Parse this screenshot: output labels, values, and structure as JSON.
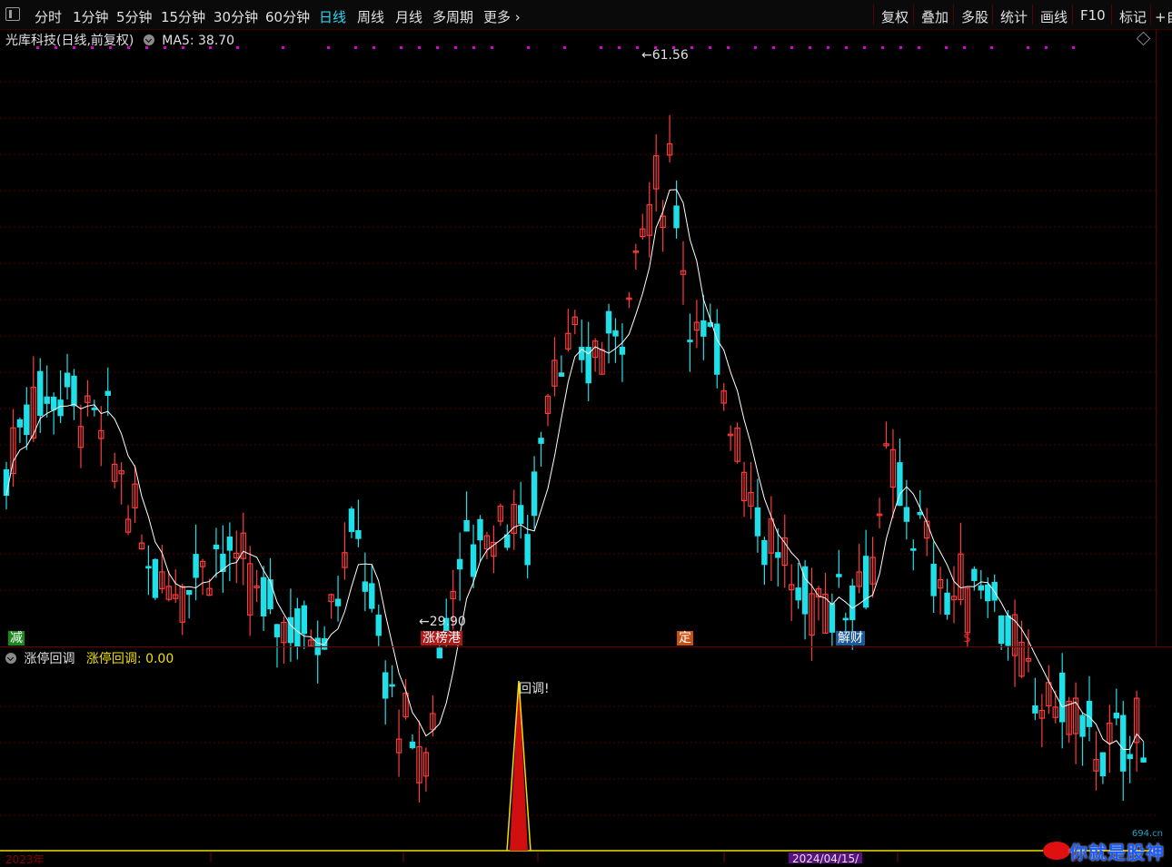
{
  "toolbar": {
    "periods": [
      "分时",
      "1分钟",
      "5分钟",
      "15分钟",
      "30分钟",
      "60分钟",
      "日线",
      "周线",
      "月线",
      "多周期",
      "更多"
    ],
    "active_period": "日线",
    "right_buttons": [
      "复权",
      "叠加",
      "多股",
      "统计",
      "画线",
      "F10",
      "标记",
      "+自"
    ]
  },
  "main_chart": {
    "stock_title": "光库科技(日线,前复权)",
    "ma_label": "MA5: 38.70",
    "high_label": "61.56",
    "low_label": "29.90",
    "colors": {
      "up": "#ff3b3b",
      "down": "#1fe0e8",
      "ma5": "#ffffff",
      "signal": "#e000e0",
      "grid": "#5a0000"
    }
  },
  "tags": [
    {
      "text": "减",
      "color": "#ffffff",
      "bg": "#1a8a1a"
    },
    {
      "text": "涨榜港",
      "color": "#ffffff",
      "bg": "#b01818"
    },
    {
      "text": "定",
      "color": "#ffffff",
      "bg": "#c85010"
    },
    {
      "text": "解财",
      "color": "#ffffff",
      "bg": "#1a5a9a"
    },
    {
      "text": "$",
      "color": "#ff2020",
      "bg": ""
    }
  ],
  "indicator": {
    "name": "涨停回调",
    "value_label": "涨停回调: 0.00",
    "peak_label": "回调!",
    "colors": {
      "line": "#f0e000",
      "peak_fill": "#d01010"
    }
  },
  "axis": {
    "year": "2023年",
    "date_box": "2024/04/15/"
  },
  "watermark": {
    "site": "694.cn",
    "text": "你就是股神"
  }
}
